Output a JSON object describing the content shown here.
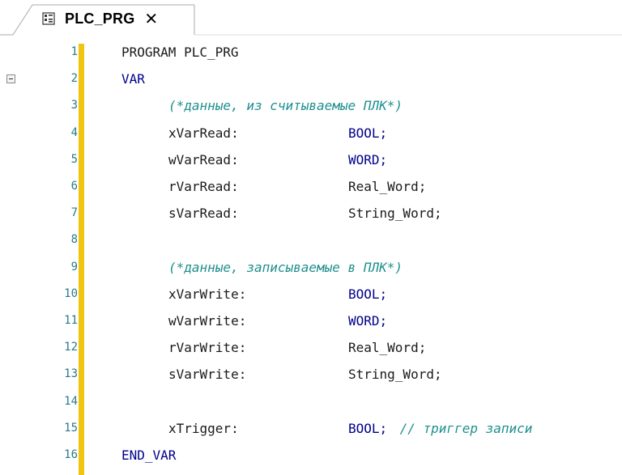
{
  "tab": {
    "label": "PLC_PRG",
    "close": "✕",
    "icon": "pou-program-icon"
  },
  "lines": [
    {
      "n": "1",
      "segs": [
        {
          "t": "PROGRAM PLC_PRG",
          "c": "id"
        }
      ],
      "indent": 0
    },
    {
      "n": "2",
      "segs": [
        {
          "t": "VAR",
          "c": "kw"
        }
      ],
      "indent": 0,
      "fold": true
    },
    {
      "n": "3",
      "segs": [
        {
          "t": "(*данные, из считываемые ПЛК*)",
          "c": "cmt"
        }
      ],
      "indent": 2
    },
    {
      "n": "4",
      "segs": [
        {
          "t": "xVarRead:",
          "c": "id"
        },
        {
          "t": "BOOL;",
          "c": "type"
        }
      ],
      "indent": 2
    },
    {
      "n": "5",
      "segs": [
        {
          "t": "wVarRead:",
          "c": "id"
        },
        {
          "t": "WORD;",
          "c": "type"
        }
      ],
      "indent": 2
    },
    {
      "n": "6",
      "segs": [
        {
          "t": "rVarRead:",
          "c": "id"
        },
        {
          "t": "Real_Word;",
          "c": "id"
        }
      ],
      "indent": 2
    },
    {
      "n": "7",
      "segs": [
        {
          "t": "sVarRead:",
          "c": "id"
        },
        {
          "t": "String_Word;",
          "c": "id"
        }
      ],
      "indent": 2
    },
    {
      "n": "8",
      "segs": [],
      "indent": 0
    },
    {
      "n": "9",
      "segs": [
        {
          "t": "(*данные, записываемые в ПЛК*)",
          "c": "cmt"
        }
      ],
      "indent": 2
    },
    {
      "n": "10",
      "segs": [
        {
          "t": "xVarWrite:",
          "c": "id"
        },
        {
          "t": "BOOL;",
          "c": "type"
        }
      ],
      "indent": 2
    },
    {
      "n": "11",
      "segs": [
        {
          "t": "wVarWrite:",
          "c": "id"
        },
        {
          "t": "WORD;",
          "c": "type"
        }
      ],
      "indent": 2
    },
    {
      "n": "12",
      "segs": [
        {
          "t": "rVarWrite:",
          "c": "id"
        },
        {
          "t": "Real_Word;",
          "c": "id"
        }
      ],
      "indent": 2
    },
    {
      "n": "13",
      "segs": [
        {
          "t": "sVarWrite:",
          "c": "id"
        },
        {
          "t": "String_Word;",
          "c": "id"
        }
      ],
      "indent": 2
    },
    {
      "n": "14",
      "segs": [],
      "indent": 0
    },
    {
      "n": "15",
      "segs": [
        {
          "t": "xTrigger:",
          "c": "id"
        },
        {
          "t": "BOOL;",
          "c": "type"
        },
        {
          "t": " // триггер записи",
          "c": "cmt"
        }
      ],
      "indent": 2
    },
    {
      "n": "16",
      "segs": [
        {
          "t": "END_VAR",
          "c": "kw"
        }
      ],
      "indent": 0
    }
  ],
  "colors": {
    "keyword": "#00008b",
    "comment": "#1f8f8f",
    "line_number": "#2b7a8a",
    "change_marker": "#f1c40f"
  }
}
